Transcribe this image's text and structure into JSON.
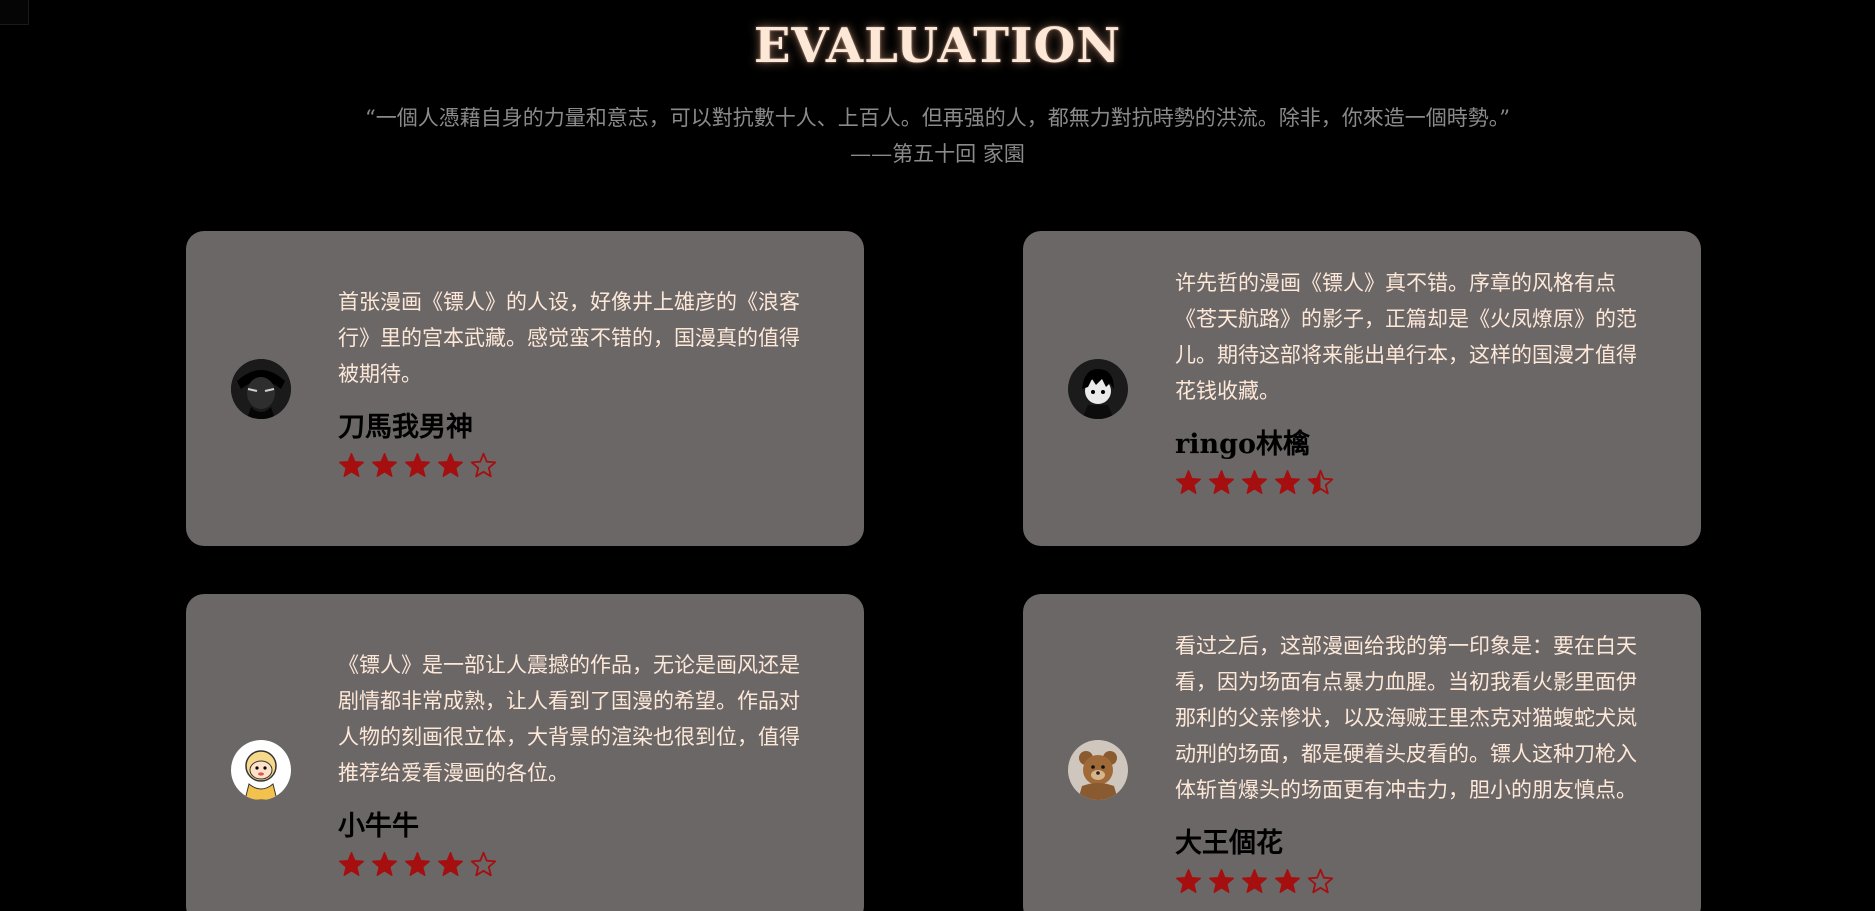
{
  "page": {
    "title": "EVALUATION",
    "quote_line1": "“一個人憑藉自身的力量和意志，可以對抗數十人、上百人。但再强的人，都無力對抗時勢的洪流。除非，你來造一個時勢。”",
    "quote_line2": "——第五十回 家園"
  },
  "colors": {
    "background": "#000000",
    "card": "#6b6767",
    "title": "#fde8d8",
    "review_text": "#fde8d8",
    "quote_text": "#8a8a8a",
    "star": "#a50f0f"
  },
  "reviews": [
    {
      "avatar_icon": "dark-anime-avatar-icon",
      "text": "首张漫画《镖人》的人设，好像井上雄彦的《浪客行》里的宫本武藏。感觉蛮不错的，国漫真的值得被期待。",
      "name": "刀馬我男神",
      "rating": 4,
      "max_rating": 5
    },
    {
      "avatar_icon": "anime-boy-avatar-icon",
      "text": "许先哲的漫画《镖人》真不错。序章的风格有点《苍天航路》的影子，正篇却是《火凤燎原》的范儿。期待这部将来能出单行本，这样的国漫才值得花钱收藏。",
      "name": "ringo林檎",
      "rating": 4.5,
      "max_rating": 5
    },
    {
      "avatar_icon": "cartoon-kid-avatar-icon",
      "text": "《镖人》是一部让人震撼的作品，无论是画风还是剧情都非常成熟，让人看到了国漫的希望。作品对人物的刻画很立体，大背景的渲染也很到位，值得推荐给爱看漫画的各位。",
      "name": "小牛牛",
      "rating": 4,
      "max_rating": 5
    },
    {
      "avatar_icon": "teddy-bear-avatar-icon",
      "text": "看过之后，这部漫画给我的第一印象是：要在白天看，因为场面有点暴力血腥。当初我看火影里面伊那利的父亲惨状，以及海贼王里杰克对猫蝮蛇犬岚动刑的场面，都是硬着头皮看的。镖人这种刀枪入体斩首爆头的场面更有冲击力，胆小的朋友慎点。",
      "name": "大王個花",
      "rating": 4,
      "max_rating": 5
    }
  ]
}
